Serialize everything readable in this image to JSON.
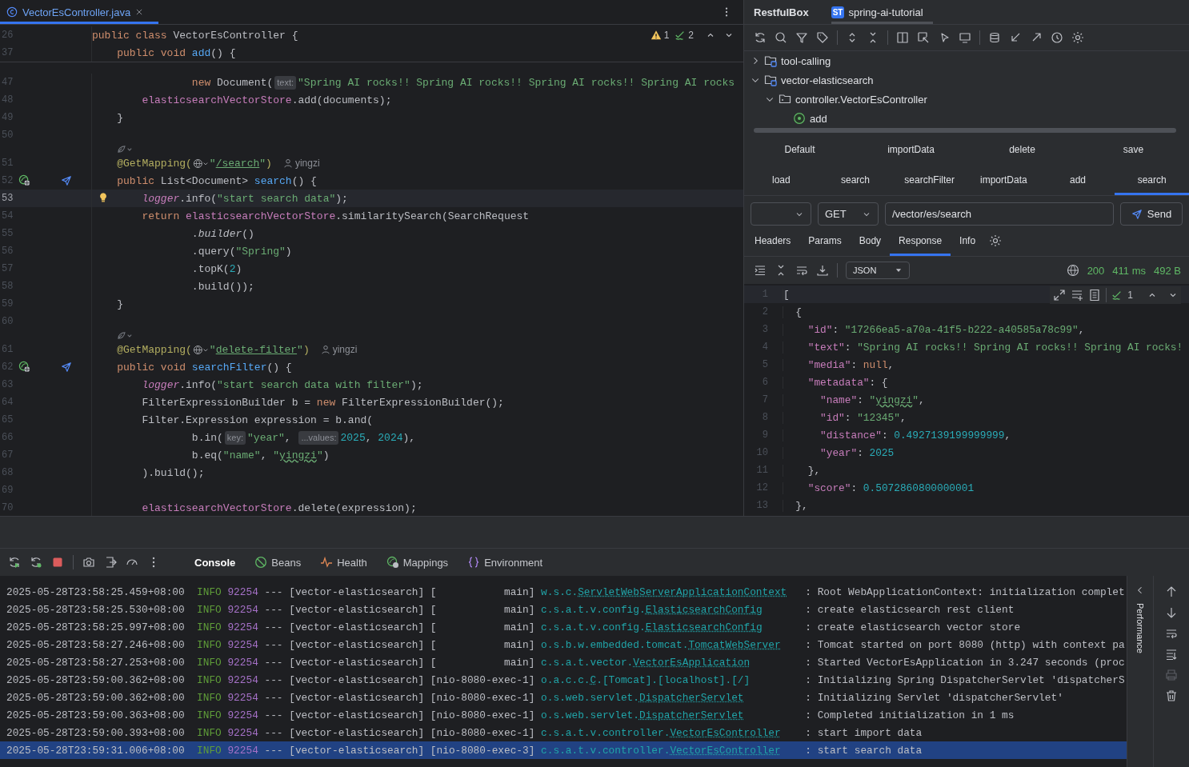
{
  "editor": {
    "tab": {
      "title": "VectorEsController.java",
      "selected": true
    },
    "inspections": {
      "warnings": "1",
      "checks": "2"
    },
    "sticky_lines": [
      {
        "num": "26",
        "tokens": [
          {
            "t": "public class ",
            "kind": "kw"
          },
          {
            "t": "VectorEsController {",
            "kind": "plain"
          }
        ]
      },
      {
        "num": "37",
        "tokens": [
          {
            "t": "    public void ",
            "kind": "kw"
          },
          {
            "t": "add",
            "kind": "fn"
          },
          {
            "t": "() {",
            "kind": "plain"
          }
        ]
      }
    ],
    "lines": [
      {
        "kind": "code",
        "num": "47",
        "current": false,
        "tokens": [
          {
            "t": "                new ",
            "kind": "kw"
          },
          {
            "t": "Document(",
            "kind": "plain"
          },
          {
            "t": "text:",
            "kind": "hint"
          },
          {
            "t": "\"Spring AI rocks!! Spring AI rocks!! Spring AI rocks!! Spring AI rocks",
            "kind": "str"
          }
        ]
      },
      {
        "kind": "code",
        "num": "48",
        "current": false,
        "tokens": [
          {
            "t": "        elasticsearchVectorStore",
            "kind": "field"
          },
          {
            "t": ".add(documents);",
            "kind": "plain"
          }
        ]
      },
      {
        "kind": "code",
        "num": "49",
        "current": false,
        "tokens": [
          {
            "t": "    }",
            "kind": "plain"
          }
        ]
      },
      {
        "kind": "code",
        "num": "50",
        "current": false
      },
      {
        "kind": "inlay",
        "current": false
      },
      {
        "kind": "code",
        "num": "51",
        "current": false,
        "tokens": [
          {
            "t": "    @GetMapping(",
            "kind": "ann"
          },
          {
            "kind": "globe"
          },
          {
            "t": "\"",
            "kind": "str"
          },
          {
            "t": "/search",
            "kind": "link"
          },
          {
            "t": "\"",
            "kind": "str"
          },
          {
            "t": ")",
            "kind": "ann"
          },
          {
            "t": "yingzi",
            "kind": "author"
          }
        ]
      },
      {
        "kind": "code",
        "num": "52",
        "current": false,
        "marker": {
          "kind": "endpoint"
        },
        "tokens": [
          {
            "t": "    public ",
            "kind": "kw"
          },
          {
            "t": "List<Document> ",
            "kind": "plain"
          },
          {
            "t": "search",
            "kind": "fn"
          },
          {
            "t": "() {",
            "kind": "plain"
          }
        ]
      },
      {
        "kind": "code",
        "num": "53",
        "current": true,
        "marker": {
          "kind": "bulb"
        },
        "tokens": [
          {
            "t": "        logger",
            "kind": "field_i"
          },
          {
            "t": ".info(",
            "kind": "plain"
          },
          {
            "t": "\"start search data\"",
            "kind": "str"
          },
          {
            "t": ");",
            "kind": "plain"
          }
        ]
      },
      {
        "kind": "code",
        "num": "54",
        "current": false,
        "tokens": [
          {
            "t": "        return ",
            "kind": "kw"
          },
          {
            "t": "elasticsearchVectorStore",
            "kind": "field"
          },
          {
            "t": ".similaritySearch(SearchRequest",
            "kind": "plain"
          }
        ]
      },
      {
        "kind": "code",
        "num": "55",
        "current": false,
        "tokens": [
          {
            "t": "                .",
            "kind": "plain"
          },
          {
            "t": "builder",
            "kind": "italic"
          },
          {
            "t": "()",
            "kind": "plain"
          }
        ]
      },
      {
        "kind": "code",
        "num": "56",
        "current": false,
        "tokens": [
          {
            "t": "                .query(",
            "kind": "plain"
          },
          {
            "t": "\"Spring\"",
            "kind": "str"
          },
          {
            "t": ")",
            "kind": "plain"
          }
        ]
      },
      {
        "kind": "code",
        "num": "57",
        "current": false,
        "tokens": [
          {
            "t": "                .topK(",
            "kind": "plain"
          },
          {
            "t": "2",
            "kind": "num"
          },
          {
            "t": ")",
            "kind": "plain"
          }
        ]
      },
      {
        "kind": "code",
        "num": "58",
        "current": false,
        "tokens": [
          {
            "t": "                .build());",
            "kind": "plain"
          }
        ]
      },
      {
        "kind": "code",
        "num": "59",
        "current": false,
        "tokens": [
          {
            "t": "    }",
            "kind": "plain"
          }
        ]
      },
      {
        "kind": "code",
        "num": "60",
        "current": false
      },
      {
        "kind": "inlay",
        "current": false
      },
      {
        "kind": "code",
        "num": "61",
        "current": false,
        "tokens": [
          {
            "t": "    @GetMapping(",
            "kind": "ann"
          },
          {
            "kind": "globe"
          },
          {
            "t": "\"",
            "kind": "str"
          },
          {
            "t": "delete-filter",
            "kind": "link"
          },
          {
            "t": "\"",
            "kind": "str"
          },
          {
            "t": ")",
            "kind": "ann"
          },
          {
            "t": "yingzi",
            "kind": "author"
          }
        ]
      },
      {
        "kind": "code",
        "num": "62",
        "current": false,
        "marker": {
          "kind": "endpoint"
        },
        "tokens": [
          {
            "t": "    public void ",
            "kind": "kw"
          },
          {
            "t": "searchFilter",
            "kind": "fn"
          },
          {
            "t": "() {",
            "kind": "plain"
          }
        ]
      },
      {
        "kind": "code",
        "num": "63",
        "current": false,
        "tokens": [
          {
            "t": "        logger",
            "kind": "field_i"
          },
          {
            "t": ".info(",
            "kind": "plain"
          },
          {
            "t": "\"start search data with filter\"",
            "kind": "str"
          },
          {
            "t": ");",
            "kind": "plain"
          }
        ]
      },
      {
        "kind": "code",
        "num": "64",
        "current": false,
        "tokens": [
          {
            "t": "        FilterExpressionBuilder b = ",
            "kind": "plain"
          },
          {
            "t": "new ",
            "kind": "kw"
          },
          {
            "t": "FilterExpressionBuilder();",
            "kind": "plain"
          }
        ]
      },
      {
        "kind": "code",
        "num": "65",
        "current": false,
        "tokens": [
          {
            "t": "        Filter.Expression expression = b.and(",
            "kind": "plain"
          }
        ]
      },
      {
        "kind": "code",
        "num": "66",
        "current": false,
        "tokens": [
          {
            "t": "                b.in(",
            "kind": "plain"
          },
          {
            "t": "key:",
            "kind": "hint"
          },
          {
            "t": "\"year\"",
            "kind": "str"
          },
          {
            "t": ", ",
            "kind": "plain"
          },
          {
            "t": "...values:",
            "kind": "hint"
          },
          {
            "t": "2025",
            "kind": "num"
          },
          {
            "t": ", ",
            "kind": "plain"
          },
          {
            "t": "2024",
            "kind": "num"
          },
          {
            "t": "),",
            "kind": "plain"
          }
        ]
      },
      {
        "kind": "code",
        "num": "67",
        "current": false,
        "tokens": [
          {
            "t": "                b.eq(",
            "kind": "plain"
          },
          {
            "t": "\"name\"",
            "kind": "str"
          },
          {
            "t": ", ",
            "kind": "plain"
          },
          {
            "t": "\"",
            "kind": "str"
          },
          {
            "t": "yingzi",
            "kind": "wavy"
          },
          {
            "t": "\"",
            "kind": "str"
          },
          {
            "t": ")",
            "kind": "plain"
          }
        ]
      },
      {
        "kind": "code",
        "num": "68",
        "current": false,
        "tokens": [
          {
            "t": "        ).build();",
            "kind": "plain"
          }
        ]
      },
      {
        "kind": "code",
        "num": "69",
        "current": false
      },
      {
        "kind": "code",
        "num": "70",
        "current": false,
        "tokens": [
          {
            "t": "        elasticsearchVectorStore",
            "kind": "field"
          },
          {
            "t": ".delete(expression);",
            "kind": "plain"
          }
        ]
      }
    ]
  },
  "restful_box": {
    "title": "RestfulBox",
    "project": {
      "badge": "ST",
      "label": "spring-ai-tutorial"
    },
    "tree": [
      {
        "label": "tool-calling",
        "kind": "module",
        "expanded": false
      },
      {
        "label": "vector-elasticsearch",
        "kind": "module",
        "expanded": true,
        "children": [
          {
            "label": "controller.VectorEsController",
            "kind": "package",
            "expanded": true,
            "children": [
              {
                "label": "add",
                "kind": "method"
              }
            ]
          }
        ]
      }
    ],
    "request_tab_rows": [
      {
        "tabs": [
          {
            "label": "Default",
            "selected": false
          },
          {
            "label": "importData",
            "selected": false
          },
          {
            "label": "delete",
            "selected": false
          },
          {
            "label": "save",
            "selected": false
          }
        ]
      },
      {
        "tabs": [
          {
            "label": "load",
            "selected": false
          },
          {
            "label": "search",
            "selected": false
          },
          {
            "label": "searchFilter",
            "selected": false
          },
          {
            "label": "importData",
            "selected": false
          },
          {
            "label": "add",
            "selected": false
          },
          {
            "label": "search",
            "selected": true
          }
        ]
      }
    ],
    "method": "GET",
    "url": "/vector/es/search",
    "send": "Send",
    "detail_tabs": [
      {
        "label": "Headers",
        "selected": false
      },
      {
        "label": "Params",
        "selected": false
      },
      {
        "label": "Body",
        "selected": false
      },
      {
        "label": "Response",
        "selected": true
      },
      {
        "label": "Info",
        "selected": false
      }
    ],
    "format": "JSON",
    "status": {
      "code": "200",
      "time": "411 ms",
      "size": "492 B"
    },
    "response": {
      "problems": "1",
      "lines": [
        {
          "num": "1",
          "current": true,
          "tokens": [
            {
              "t": "[",
              "kind": "plain"
            }
          ]
        },
        {
          "num": "2",
          "current": false,
          "tokens": [
            {
              "t": "  {",
              "kind": "plain"
            }
          ]
        },
        {
          "num": "3",
          "current": false,
          "tokens": [
            {
              "t": "    \"id\"",
              "kind": "key"
            },
            {
              "t": ": ",
              "kind": "plain"
            },
            {
              "t": "\"17266ea5-a70a-41f5-b222-a40585a78c99\"",
              "kind": "str"
            },
            {
              "t": ",",
              "kind": "plain"
            }
          ]
        },
        {
          "num": "4",
          "current": false,
          "tokens": [
            {
              "t": "    \"text\"",
              "kind": "key"
            },
            {
              "t": ": ",
              "kind": "plain"
            },
            {
              "t": "\"Spring AI rocks!! Spring AI rocks!! Spring AI rocks!",
              "kind": "str"
            }
          ]
        },
        {
          "num": "5",
          "current": false,
          "tokens": [
            {
              "t": "    \"media\"",
              "kind": "key"
            },
            {
              "t": ": ",
              "kind": "plain"
            },
            {
              "t": "null",
              "kind": "kw"
            },
            {
              "t": ",",
              "kind": "plain"
            }
          ]
        },
        {
          "num": "6",
          "current": false,
          "tokens": [
            {
              "t": "    \"metadata\"",
              "kind": "key"
            },
            {
              "t": ": {",
              "kind": "plain"
            }
          ]
        },
        {
          "num": "7",
          "current": false,
          "tokens": [
            {
              "t": "      \"name\"",
              "kind": "key"
            },
            {
              "t": ": ",
              "kind": "plain"
            },
            {
              "t": "\"",
              "kind": "str"
            },
            {
              "t": "yingzi",
              "kind": "wavy"
            },
            {
              "t": "\"",
              "kind": "str"
            },
            {
              "t": ",",
              "kind": "plain"
            }
          ]
        },
        {
          "num": "8",
          "current": false,
          "tokens": [
            {
              "t": "      \"id\"",
              "kind": "key"
            },
            {
              "t": ": ",
              "kind": "plain"
            },
            {
              "t": "\"12345\"",
              "kind": "str"
            },
            {
              "t": ",",
              "kind": "plain"
            }
          ]
        },
        {
          "num": "9",
          "current": false,
          "tokens": [
            {
              "t": "      \"distance\"",
              "kind": "key"
            },
            {
              "t": ": ",
              "kind": "plain"
            },
            {
              "t": "0.4927139199999999",
              "kind": "num"
            },
            {
              "t": ",",
              "kind": "plain"
            }
          ]
        },
        {
          "num": "10",
          "current": false,
          "tokens": [
            {
              "t": "      \"year\"",
              "kind": "key"
            },
            {
              "t": ": ",
              "kind": "plain"
            },
            {
              "t": "2025",
              "kind": "num"
            }
          ]
        },
        {
          "num": "11",
          "current": false,
          "tokens": [
            {
              "t": "    },",
              "kind": "plain"
            }
          ]
        },
        {
          "num": "12",
          "current": false,
          "tokens": [
            {
              "t": "    \"score\"",
              "kind": "key"
            },
            {
              "t": ": ",
              "kind": "plain"
            },
            {
              "t": "0.5072860800000001",
              "kind": "num"
            }
          ]
        },
        {
          "num": "13",
          "current": false,
          "tokens": [
            {
              "t": "  },",
              "kind": "plain"
            }
          ]
        }
      ]
    }
  },
  "run_panel": {
    "tabs": [
      {
        "label": "Console",
        "kind": "console",
        "selected": true
      },
      {
        "label": "Beans",
        "kind": "beans",
        "selected": false
      },
      {
        "label": "Health",
        "kind": "health",
        "selected": false
      },
      {
        "label": "Mappings",
        "kind": "mappings",
        "selected": false
      },
      {
        "label": "Environment",
        "kind": "environment",
        "selected": false
      }
    ],
    "side_label": "Performance",
    "log": [
      {
        "time": "2025-05-28T23:58:25.459+08:00",
        "level": "INFO",
        "pid": "92254",
        "sep": "---",
        "app": "[vector-elasticsearch]",
        "thread": "[           main]",
        "logger": {
          "pkg": "w.s.c.",
          "cls": "ServletWebServerApplicationContext"
        },
        "message": ": Root WebApplicationContext: initialization complet",
        "selected": false
      },
      {
        "time": "2025-05-28T23:58:25.530+08:00",
        "level": "INFO",
        "pid": "92254",
        "sep": "---",
        "app": "[vector-elasticsearch]",
        "thread": "[           main]",
        "logger": {
          "pkg": "c.s.a.t.v.config.",
          "cls": "ElasticsearchConfig"
        },
        "message": ": create elasticsearch rest client",
        "selected": false
      },
      {
        "time": "2025-05-28T23:58:25.997+08:00",
        "level": "INFO",
        "pid": "92254",
        "sep": "---",
        "app": "[vector-elasticsearch]",
        "thread": "[           main]",
        "logger": {
          "pkg": "c.s.a.t.v.config.",
          "cls": "ElasticsearchConfig"
        },
        "message": ": create elasticsearch vector store",
        "selected": false
      },
      {
        "time": "2025-05-28T23:58:27.246+08:00",
        "level": "INFO",
        "pid": "92254",
        "sep": "---",
        "app": "[vector-elasticsearch]",
        "thread": "[           main]",
        "logger": {
          "pkg": "o.s.b.w.embedded.tomcat.",
          "cls": "TomcatWebServer"
        },
        "message": ": Tomcat started on port 8080 (http) with context pa",
        "selected": false
      },
      {
        "time": "2025-05-28T23:58:27.253+08:00",
        "level": "INFO",
        "pid": "92254",
        "sep": "---",
        "app": "[vector-elasticsearch]",
        "thread": "[           main]",
        "logger": {
          "pkg": "c.s.a.t.vector.",
          "cls": "VectorEsApplication"
        },
        "message": ": Started VectorEsApplication in 3.247 seconds (proc",
        "selected": false
      },
      {
        "time": "2025-05-28T23:59:00.362+08:00",
        "level": "INFO",
        "pid": "92254",
        "sep": "---",
        "app": "[vector-elasticsearch]",
        "thread": "[nio-8080-exec-1]",
        "logger": {
          "pkg": "o.a.c.c.",
          "cls": "C",
          "rest": ".[Tomcat].[localhost].[/]"
        },
        "message": ": Initializing Spring DispatcherServlet 'dispatcherS",
        "selected": false
      },
      {
        "time": "2025-05-28T23:59:00.362+08:00",
        "level": "INFO",
        "pid": "92254",
        "sep": "---",
        "app": "[vector-elasticsearch]",
        "thread": "[nio-8080-exec-1]",
        "logger": {
          "pkg": "o.s.web.servlet.",
          "cls": "DispatcherServlet"
        },
        "message": ": Initializing Servlet 'dispatcherServlet'",
        "selected": false
      },
      {
        "time": "2025-05-28T23:59:00.363+08:00",
        "level": "INFO",
        "pid": "92254",
        "sep": "---",
        "app": "[vector-elasticsearch]",
        "thread": "[nio-8080-exec-1]",
        "logger": {
          "pkg": "o.s.web.servlet.",
          "cls": "DispatcherServlet"
        },
        "message": ": Completed initialization in 1 ms",
        "selected": false
      },
      {
        "time": "2025-05-28T23:59:00.393+08:00",
        "level": "INFO",
        "pid": "92254",
        "sep": "---",
        "app": "[vector-elasticsearch]",
        "thread": "[nio-8080-exec-1]",
        "logger": {
          "pkg": "c.s.a.t.v.controller.",
          "cls": "VectorEsController"
        },
        "message": ": start import data",
        "selected": false
      },
      {
        "time": "2025-05-28T23:59:31.006+08:00",
        "level": "INFO",
        "pid": "92254",
        "sep": "---",
        "app": "[vector-elasticsearch]",
        "thread": "[nio-8080-exec-3]",
        "logger": {
          "pkg": "c.s.a.t.v.controller.",
          "cls": "VectorEsController"
        },
        "message": ": start search data",
        "selected": true
      }
    ]
  }
}
